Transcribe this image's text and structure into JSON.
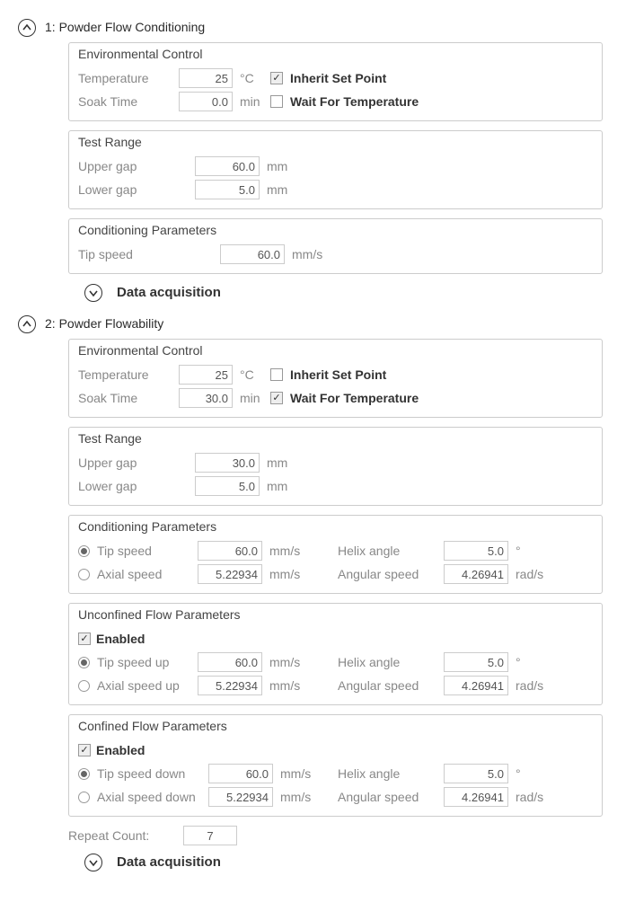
{
  "section1": {
    "title": "1: Powder Flow Conditioning",
    "env": {
      "legend": "Environmental Control",
      "temp_label": "Temperature",
      "temp_value": "25",
      "temp_unit": "°C",
      "inherit_label": "Inherit Set Point",
      "inherit_checked": true,
      "soak_label": "Soak Time",
      "soak_value": "0.0",
      "soak_unit": "min",
      "wait_label": "Wait For Temperature",
      "wait_checked": false
    },
    "range": {
      "legend": "Test Range",
      "upper_label": "Upper gap",
      "upper_value": "60.0",
      "upper_unit": "mm",
      "lower_label": "Lower gap",
      "lower_value": "5.0",
      "lower_unit": "mm"
    },
    "cond": {
      "legend": "Conditioning Parameters",
      "tip_label": "Tip speed",
      "tip_value": "60.0",
      "tip_unit": "mm/s"
    },
    "data_acq": "Data acquisition"
  },
  "section2": {
    "title": "2: Powder Flowability",
    "env": {
      "legend": "Environmental Control",
      "temp_label": "Temperature",
      "temp_value": "25",
      "temp_unit": "°C",
      "inherit_label": "Inherit Set Point",
      "inherit_checked": false,
      "soak_label": "Soak Time",
      "soak_value": "30.0",
      "soak_unit": "min",
      "wait_label": "Wait For Temperature",
      "wait_checked": true
    },
    "range": {
      "legend": "Test Range",
      "upper_label": "Upper gap",
      "upper_value": "30.0",
      "upper_unit": "mm",
      "lower_label": "Lower gap",
      "lower_value": "5.0",
      "lower_unit": "mm"
    },
    "cond": {
      "legend": "Conditioning Parameters",
      "tip_label": "Tip speed",
      "tip_value": "60.0",
      "tip_unit": "mm/s",
      "axial_label": "Axial speed",
      "axial_value": "5.22934",
      "axial_unit": "mm/s",
      "helix_label": "Helix angle",
      "helix_value": "5.0",
      "helix_unit": "°",
      "ang_label": "Angular speed",
      "ang_value": "4.26941",
      "ang_unit": "rad/s"
    },
    "unconf": {
      "legend": "Unconfined Flow Parameters",
      "enabled_label": "Enabled",
      "enabled": true,
      "tip_label": "Tip speed up",
      "tip_value": "60.0",
      "tip_unit": "mm/s",
      "axial_label": "Axial speed up",
      "axial_value": "5.22934",
      "axial_unit": "mm/s",
      "helix_label": "Helix angle",
      "helix_value": "5.0",
      "helix_unit": "°",
      "ang_label": "Angular speed",
      "ang_value": "4.26941",
      "ang_unit": "rad/s"
    },
    "conf": {
      "legend": "Confined Flow Parameters",
      "enabled_label": "Enabled",
      "enabled": true,
      "tip_label": "Tip speed down",
      "tip_value": "60.0",
      "tip_unit": "mm/s",
      "axial_label": "Axial speed down",
      "axial_value": "5.22934",
      "axial_unit": "mm/s",
      "helix_label": "Helix angle",
      "helix_value": "5.0",
      "helix_unit": "°",
      "ang_label": "Angular speed",
      "ang_value": "4.26941",
      "ang_unit": "rad/s"
    },
    "repeat_label": "Repeat Count:",
    "repeat_value": "7",
    "data_acq": "Data acquisition"
  }
}
